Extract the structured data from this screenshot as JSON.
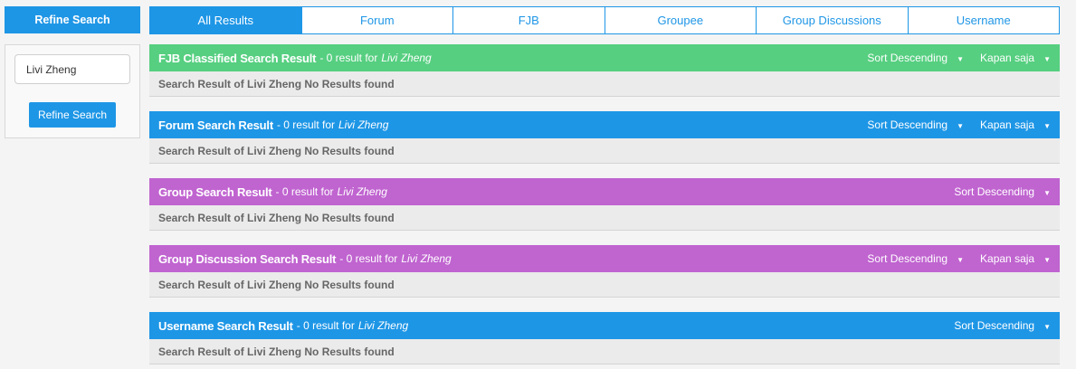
{
  "sidebar": {
    "header": "Refine Search",
    "search_value": "Livi Zheng",
    "button_label": "Refine Search"
  },
  "tabs": [
    {
      "label": "All Results",
      "active": true
    },
    {
      "label": "Forum",
      "active": false
    },
    {
      "label": "FJB",
      "active": false
    },
    {
      "label": "Groupee",
      "active": false
    },
    {
      "label": "Group Discussions",
      "active": false
    },
    {
      "label": "Username",
      "active": false
    }
  ],
  "colors": {
    "blue": "#1e96e6",
    "green": "#56cf80",
    "purple": "#c064d0"
  },
  "sections": [
    {
      "title": "FJB Classified Search Result",
      "count": "- 0 result for",
      "query": "Livi Zheng",
      "sort_label": "Sort Descending",
      "time_label": "Kapan saja",
      "body": "Search Result of Livi Zheng No Results found"
    },
    {
      "title": "Forum Search Result",
      "count": "- 0 result for",
      "query": "Livi Zheng",
      "sort_label": "Sort Descending",
      "time_label": "Kapan saja",
      "body": "Search Result of Livi Zheng No Results found"
    },
    {
      "title": "Group Search Result",
      "count": "- 0 result for",
      "query": "Livi Zheng",
      "sort_label": "Sort Descending",
      "body": "Search Result of Livi Zheng No Results found"
    },
    {
      "title": "Group Discussion Search Result",
      "count": "- 0 result for",
      "query": "Livi Zheng",
      "sort_label": "Sort Descending",
      "time_label": "Kapan saja",
      "body": "Search Result of Livi Zheng No Results found"
    },
    {
      "title": "Username Search Result",
      "count": "- 0 result for",
      "query": "Livi Zheng",
      "sort_label": "Sort Descending",
      "body": "Search Result of Livi Zheng No Results found"
    }
  ]
}
